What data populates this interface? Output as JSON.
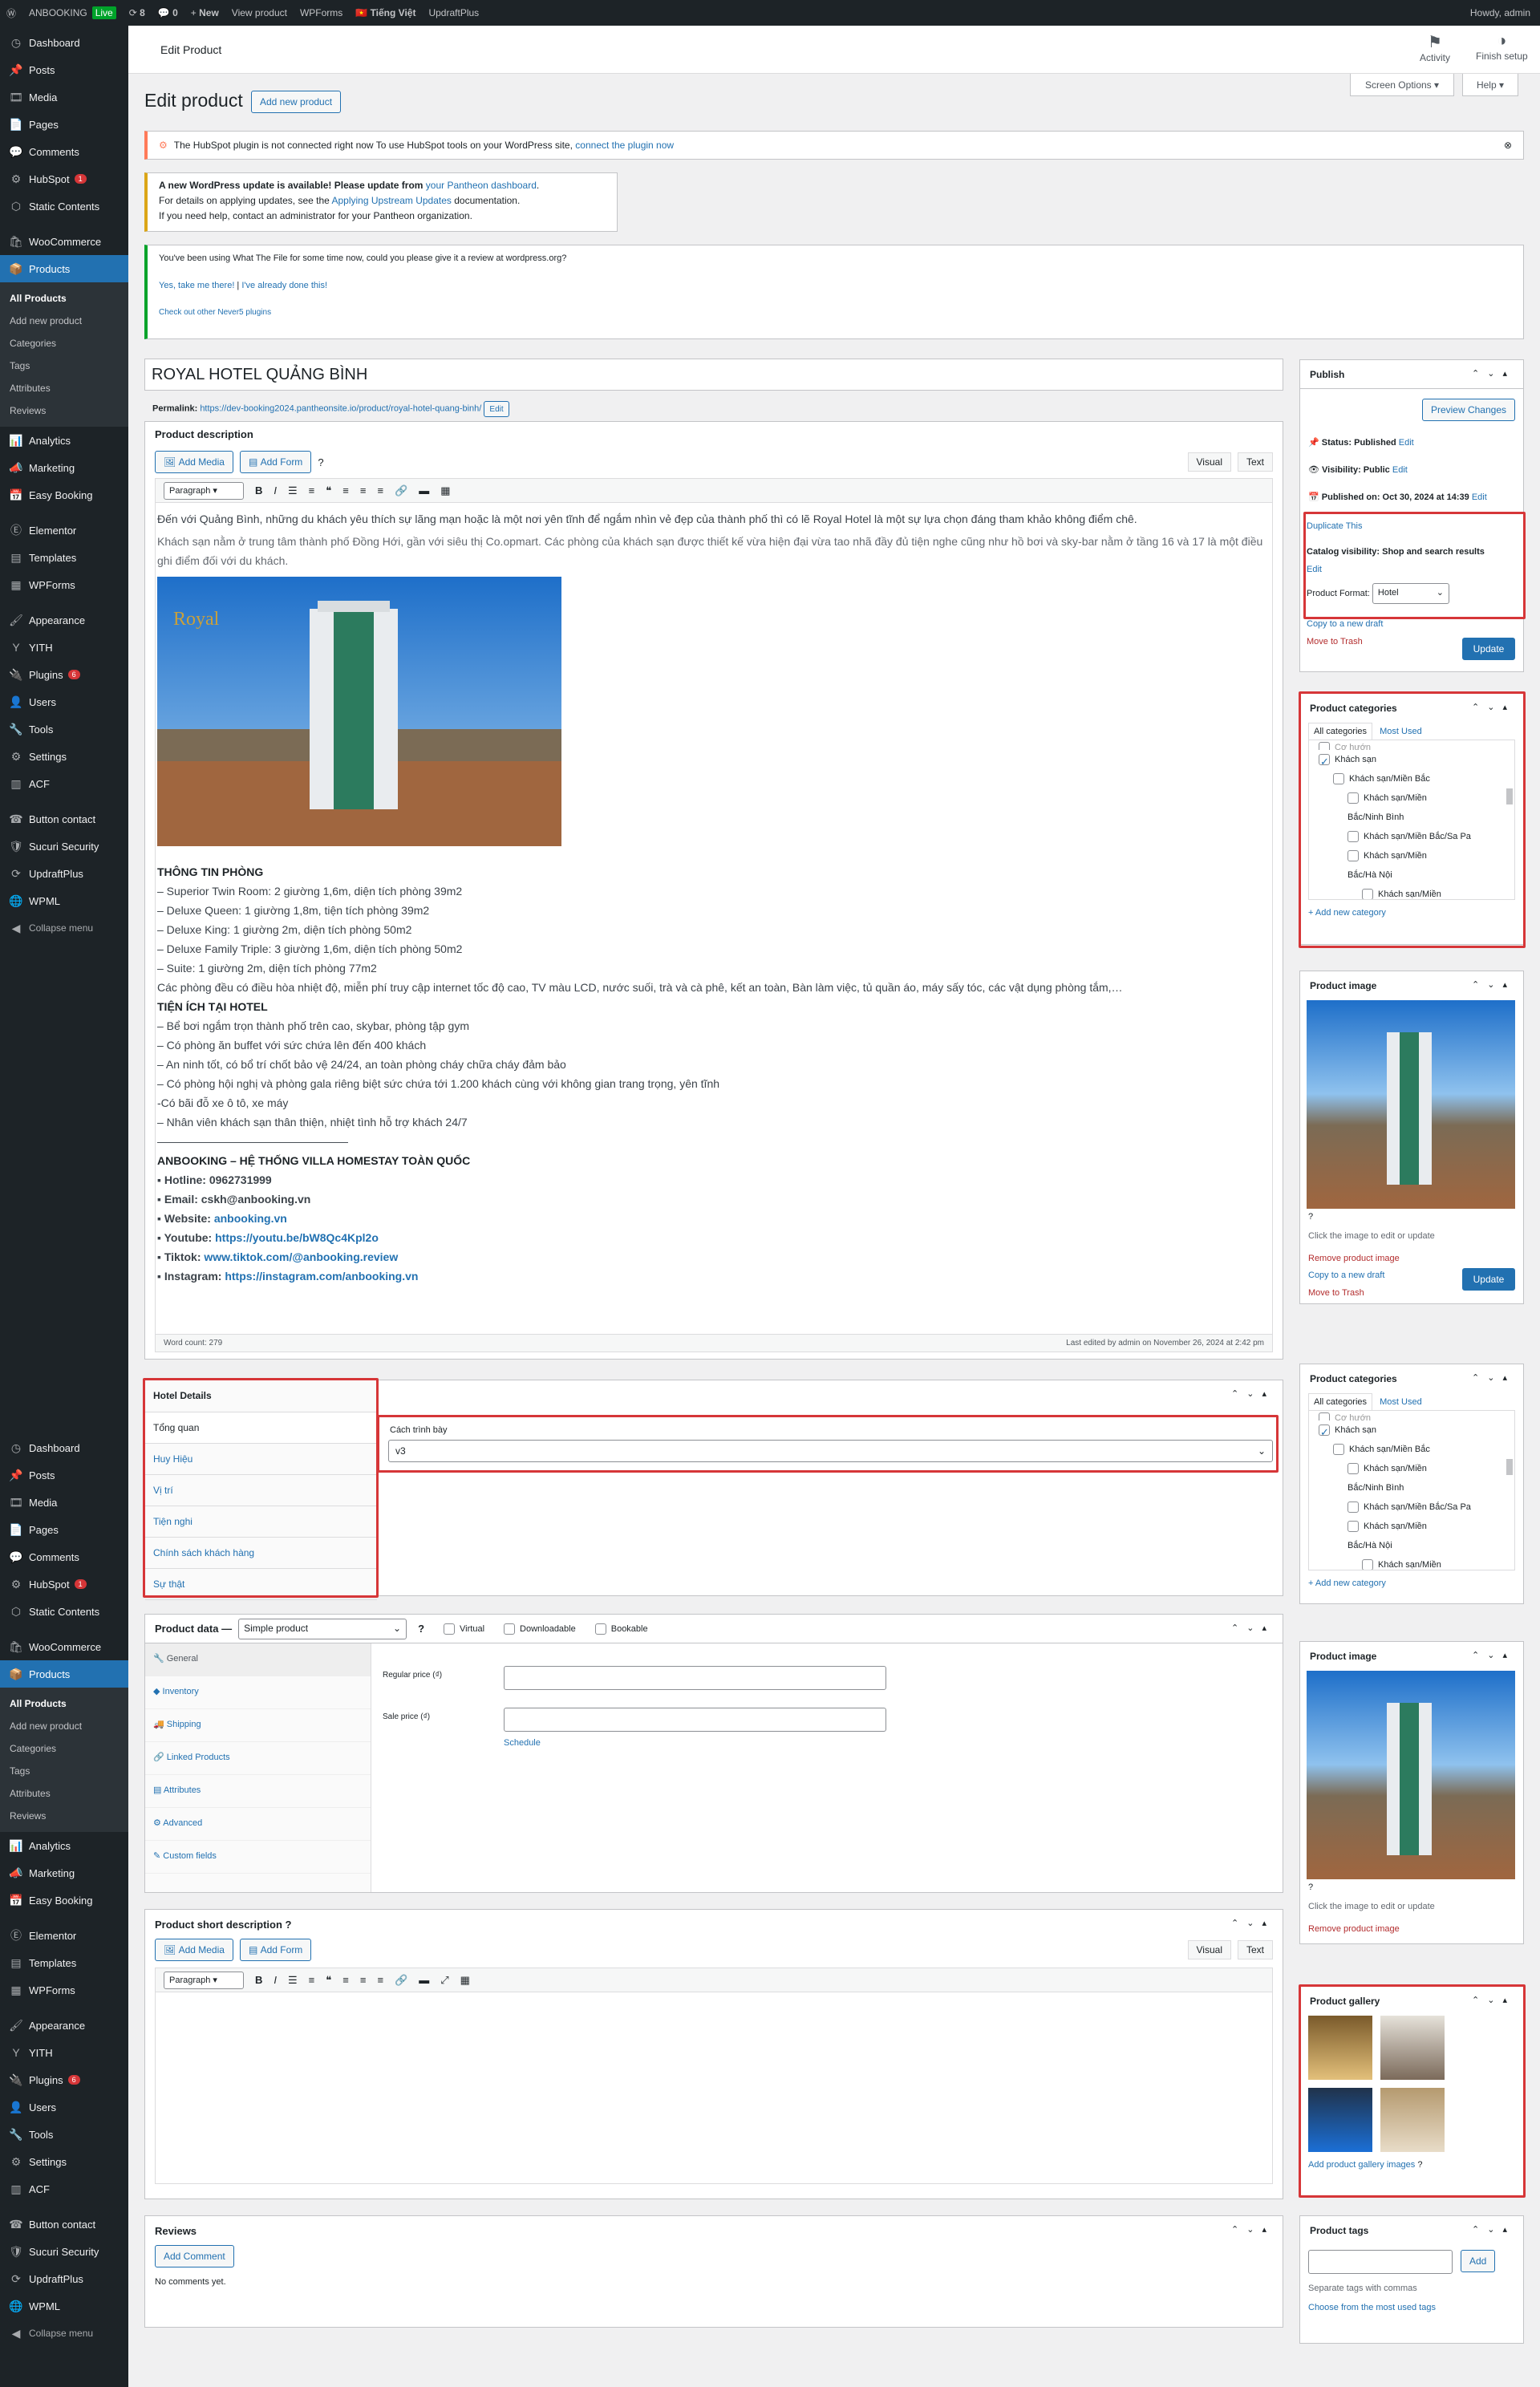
{
  "adminbar": {
    "site": "ANBOOKING",
    "live": "Live",
    "updates": "8",
    "comments": "0",
    "new": "New",
    "view": "View product",
    "wpforms": "WPForms",
    "lang": "Tiếng Việt",
    "updraft": "UpdraftPlus",
    "howdy": "Howdy, admin"
  },
  "menu1": [
    {
      "icon": "dashboard-icon",
      "label": "Dashboard"
    },
    {
      "icon": "posts-icon",
      "label": "Posts"
    },
    {
      "icon": "media-icon",
      "label": "Media"
    },
    {
      "icon": "pages-icon",
      "label": "Pages"
    },
    {
      "icon": "comments-icon",
      "label": "Comments"
    },
    {
      "icon": "hubspot-icon",
      "label": "HubSpot",
      "badge": "1"
    },
    {
      "icon": "static-icon",
      "label": "Static Contents"
    },
    {
      "icon": "woo-icon",
      "label": "WooCommerce"
    },
    {
      "icon": "products-icon",
      "label": "Products",
      "active": true
    }
  ],
  "menu_sub": [
    "All Products",
    "Add new product",
    "Categories",
    "Tags",
    "Attributes",
    "Reviews"
  ],
  "menu2": [
    {
      "icon": "analytics-icon",
      "label": "Analytics"
    },
    {
      "icon": "marketing-icon",
      "label": "Marketing"
    },
    {
      "icon": "booking-icon",
      "label": "Easy Booking"
    },
    {
      "icon": "elementor-icon",
      "label": "Elementor"
    },
    {
      "icon": "templates-icon",
      "label": "Templates"
    },
    {
      "icon": "wpforms-icon",
      "label": "WPForms"
    },
    {
      "icon": "appearance-icon",
      "label": "Appearance"
    },
    {
      "icon": "yith-icon",
      "label": "YITH"
    },
    {
      "icon": "plugins-icon",
      "label": "Plugins",
      "badge": "6"
    },
    {
      "icon": "users-icon",
      "label": "Users"
    },
    {
      "icon": "tools-icon",
      "label": "Tools"
    },
    {
      "icon": "settings-icon",
      "label": "Settings"
    },
    {
      "icon": "acf-icon",
      "label": "ACF"
    },
    {
      "icon": "button-icon",
      "label": "Button contact"
    },
    {
      "icon": "sucuri-icon",
      "label": "Sucuri Security"
    },
    {
      "icon": "updraft-icon",
      "label": "UpdraftPlus"
    },
    {
      "icon": "wpml-icon",
      "label": "WPML"
    },
    {
      "icon": "collapse-icon",
      "label": "Collapse menu"
    }
  ],
  "top": {
    "title": "Edit Product",
    "activity": "Activity",
    "finish": "Finish setup",
    "screen": "Screen Options ▾",
    "help": "Help ▾"
  },
  "page": {
    "title": "Edit product",
    "add_new": "Add new product"
  },
  "notices": {
    "hubspot": "The HubSpot plugin is not connected right now To use HubSpot tools on your WordPress site,",
    "hubspot_link": "connect the plugin now",
    "update1": "A new WordPress update is available! Please update from",
    "update1_link": "your Pantheon dashboard",
    "update2": "For details on applying updates, see the",
    "update2_link": "Applying Upstream Updates",
    "update2b": "documentation.",
    "update3": "If you need help, contact an administrator for your Pantheon organization.",
    "wtf1": "You've been using What The File for some time now, could you please give it a review at wordpress.org?",
    "wtf_yes": "Yes, take me there!",
    "wtf_done": "I've already done this!",
    "wtf_other": "Check out other Never5 plugins"
  },
  "product": {
    "name": "ROYAL HOTEL QUẢNG BÌNH",
    "permalink_label": "Permalink:",
    "permalink": "https://dev-booking2024.pantheonsite.io/product/royal-hotel-quang-binh/",
    "edit": "Edit"
  },
  "desc": {
    "title": "Product description",
    "add_media": "Add Media",
    "add_form": "Add Form",
    "visual": "Visual",
    "text": "Text",
    "paragraph": "Paragraph",
    "intro1": "Đến với Quảng Bình, những du khách yêu thích sự lãng mạn hoặc là một nơi yên tĩnh để ngắm nhìn vẻ đẹp của thành phố thì có lẽ Royal Hotel là một sự lựa chọn đáng tham khảo không điểm chê.",
    "intro2": "Khách sạn nằm ở trung tâm thành phố Đồng Hới, gần với siêu thị Co.opmart. Các phòng của khách sạn được thiết kế vừa hiện đại vừa tao nhã đầy đủ tiện nghe cũng như hồ bơi và sky-bar nằm ở tầng 16 và 17 là một điều ghi điểm đối với du khách.",
    "lines": [
      {
        "t": "THÔNG TIN PHÒNG",
        "b": true
      },
      {
        "t": "– Superior Twin Room: 2 giường 1,6m, diện tích phòng 39m2"
      },
      {
        "t": "– Deluxe Queen: 1 giường 1,8m, tiện tích phòng 39m2"
      },
      {
        "t": "– Deluxe King: 1 giường 2m, diện tích phòng 50m2"
      },
      {
        "t": "– Deluxe Family Triple: 3 giường 1,6m, diện tích phòng 50m2"
      },
      {
        "t": "– Suite: 1 giường 2m, diện tích phòng 77m2"
      },
      {
        "t": "Các phòng đều có điều hòa nhiệt độ, miễn phí truy cập internet tốc độ cao, TV màu LCD, nước suối, trà và cà phê, kết an toàn, Bàn làm việc, tủ quần áo, máy sấy tóc, các vật dụng phòng tắm,…"
      },
      {
        "t": "TIỆN ÍCH TẠI HOTEL",
        "b": true
      },
      {
        "t": "– Bể bơi ngắm trọn thành phố trên cao, skybar, phòng tập gym"
      },
      {
        "t": "– Có phòng ăn buffet với sức chứa lên đến 400 khách"
      },
      {
        "t": "– An ninh tốt, có bổ trí chốt bảo vệ 24/24, an toàn phòng cháy chữa cháy đảm bảo"
      },
      {
        "t": "– Có phòng hội nghị và phòng gala riêng biệt sức chứa tới 1.200 khách cùng với không gian trang trọng, yên tĩnh"
      },
      {
        "t": "-Có bãi đỗ xe ô tô, xe máy"
      },
      {
        "t": "– Nhân viên khách sạn thân thiện, nhiệt tình hỗ trợ khách 24/7"
      },
      {
        "t": "—————————————————"
      },
      {
        "t": "ANBOOKING – HỆ THỐNG VILLA HOMESTAY TOÀN QUỐC",
        "b": true
      }
    ],
    "contacts": [
      {
        "k": "Hotline:",
        "v": "0962731999",
        "link": false
      },
      {
        "k": "Email:",
        "v": "cskh@anbooking.vn",
        "link": false
      },
      {
        "k": "Website:",
        "v": "anbooking.vn",
        "link": true
      },
      {
        "k": "Youtube:",
        "v": "https://youtu.be/bW8Qc4Kpl2o",
        "link": true
      },
      {
        "k": "Tiktok:",
        "v": "www.tiktok.com/@anbooking.review",
        "link": true
      },
      {
        "k": "Instagram:",
        "v": "https://instagram.com/anbooking.vn",
        "link": true
      }
    ],
    "word_count": "Word count: 279",
    "last_edited": "Last edited by admin on November 26, 2024 at 2:42 pm"
  },
  "hotel": {
    "title": "Hotel Details",
    "tabs": [
      "Tổng quan",
      "Huy Hiệu",
      "Vị trí",
      "Tiện nghi",
      "Chính sách khách hàng",
      "Sự thật"
    ],
    "field_label": "Cách trình bày",
    "field_value": "v3"
  },
  "pdata": {
    "title": "Product data —",
    "type": "Simple product",
    "virtual": "Virtual",
    "downloadable": "Downloadable",
    "bookable": "Bookable",
    "tabs": [
      "General",
      "Inventory",
      "Shipping",
      "Linked Products",
      "Attributes",
      "Advanced",
      "Custom fields"
    ],
    "regular": "Regular price (₫)",
    "sale": "Sale price (₫)",
    "schedule": "Schedule"
  },
  "short": {
    "title": "Product short description",
    "add_media": "Add Media",
    "add_form": "Add Form",
    "visual": "Visual",
    "text": "Text",
    "paragraph": "Paragraph"
  },
  "reviews": {
    "title": "Reviews",
    "add": "Add Comment",
    "none": "No comments yet."
  },
  "publish": {
    "title": "Publish",
    "preview": "Preview Changes",
    "status": "Status: Published",
    "visibility": "Visibility: Public",
    "published": "Published on: Oct 30, 2024 at 14:39",
    "edit": "Edit",
    "duplicate": "Duplicate This",
    "catalog": "Catalog visibility: Shop and search results",
    "format_label": "Product Format:",
    "format": "Hotel",
    "copy": "Copy to a new draft",
    "trash": "Move to Trash",
    "update": "Update"
  },
  "cats": {
    "title": "Product categories",
    "all": "All categories",
    "most": "Most Used",
    "items": [
      {
        "t": "Cơ hướn",
        "ind": 1,
        "c": false,
        "cut": true
      },
      {
        "t": "Khách sạn",
        "ind": 1,
        "c": true
      },
      {
        "t": "Khách sạn/Miền Bắc",
        "ind": 2,
        "c": false
      },
      {
        "t": "Khách sạn/Miền",
        "ind": 3,
        "c": false
      },
      {
        "t": "Bắc/Ninh Bình",
        "ind": 3,
        "c": null
      },
      {
        "t": "Khách sạn/Miền Bắc/Sa Pa",
        "ind": 3,
        "c": false
      },
      {
        "t": "Khách sạn/Miền",
        "ind": 3,
        "c": false
      },
      {
        "t": "Bắc/Hà Nội",
        "ind": 3,
        "c": null
      },
      {
        "t": "Khách sạn/Miền",
        "ind": 4,
        "c": false
      }
    ],
    "add": "+ Add new category"
  },
  "pimage": {
    "title": "Product image",
    "hint": "Click the image to edit or update",
    "remove": "Remove product image"
  },
  "gallery": {
    "title": "Product gallery",
    "add": "Add product gallery images"
  },
  "tags": {
    "title": "Product tags",
    "add": "Add",
    "sep": "Separate tags with commas",
    "choose": "Choose from the most used tags"
  },
  "colors": {
    "accent": "#2271b1",
    "sidebar": "#1d2327",
    "highlight": "#d63638"
  }
}
